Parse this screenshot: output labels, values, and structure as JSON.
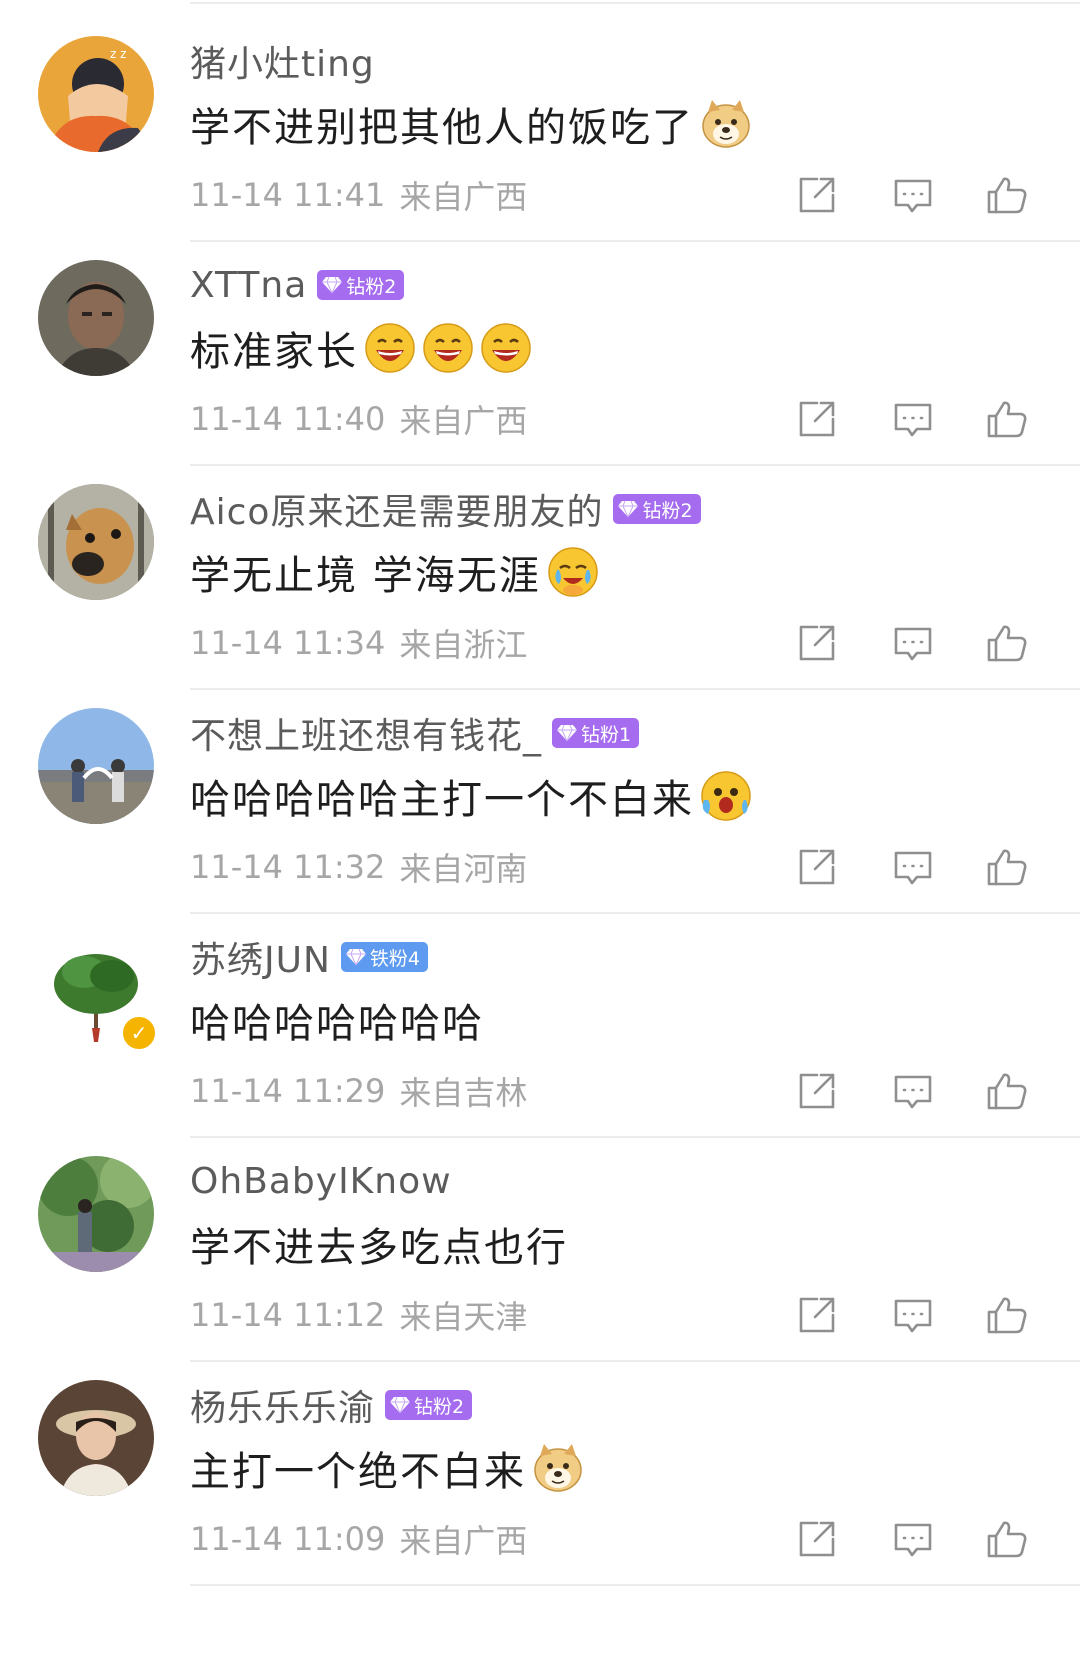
{
  "colors": {
    "fan_badge_diamond": "#a56cf0",
    "fan_badge_iron": "#5e9bf0",
    "verified": "#f5b400",
    "meta_text": "#a6a6a6",
    "icon_stroke": "#8f8f8f"
  },
  "icons": {
    "share": "share-out-icon",
    "comment": "comment-bubble-icon",
    "like": "thumbs-up-icon",
    "fan_gem": "diamond-gem-icon"
  },
  "comments": [
    {
      "username": "猪小灶ting",
      "badge": "",
      "badge_type": "",
      "verified": false,
      "text": "学不进别把其他人的饭吃了",
      "emojis": [
        "doge"
      ],
      "date": "11-14 11:41",
      "location": "来自广西",
      "avatar": "anime-avatar"
    },
    {
      "username": "XTTna",
      "badge": "钻粉2",
      "badge_type": "diamond",
      "verified": false,
      "text": "标准家长",
      "emojis": [
        "laugh",
        "laugh",
        "laugh"
      ],
      "date": "11-14 11:40",
      "location": "来自广西",
      "avatar": "man-portrait-avatar"
    },
    {
      "username": "Aico原来还是需要朋友的",
      "badge": "钻粉2",
      "badge_type": "diamond",
      "verified": false,
      "text": "学无止境 学海无涯",
      "emojis": [
        "cry-laugh"
      ],
      "date": "11-14 11:34",
      "location": "来自浙江",
      "avatar": "dog-avatar"
    },
    {
      "username": "不想上班还想有钱花_",
      "badge": "钻粉1",
      "badge_type": "diamond",
      "verified": false,
      "text": "哈哈哈哈哈主打一个不白来",
      "emojis": [
        "wow"
      ],
      "date": "11-14 11:32",
      "location": "来自河南",
      "avatar": "outdoor-people-avatar"
    },
    {
      "username": "苏绣JUN",
      "badge": "铁粉4",
      "badge_type": "iron",
      "verified": true,
      "text": "哈哈哈哈哈哈哈",
      "emojis": [],
      "date": "11-14 11:29",
      "location": "来自吉林",
      "avatar": "plant-avatar"
    },
    {
      "username": "OhBabyIKnow",
      "badge": "",
      "badge_type": "",
      "verified": false,
      "text": "学不进去多吃点也行",
      "emojis": [],
      "date": "11-14 11:12",
      "location": "来自天津",
      "avatar": "forest-avatar"
    },
    {
      "username": "杨乐乐乐渝",
      "badge": "钻粉2",
      "badge_type": "diamond",
      "verified": false,
      "text": "主打一个绝不白来",
      "emojis": [
        "doge"
      ],
      "date": "11-14 11:09",
      "location": "来自广西",
      "avatar": "woman-portrait-avatar"
    }
  ]
}
